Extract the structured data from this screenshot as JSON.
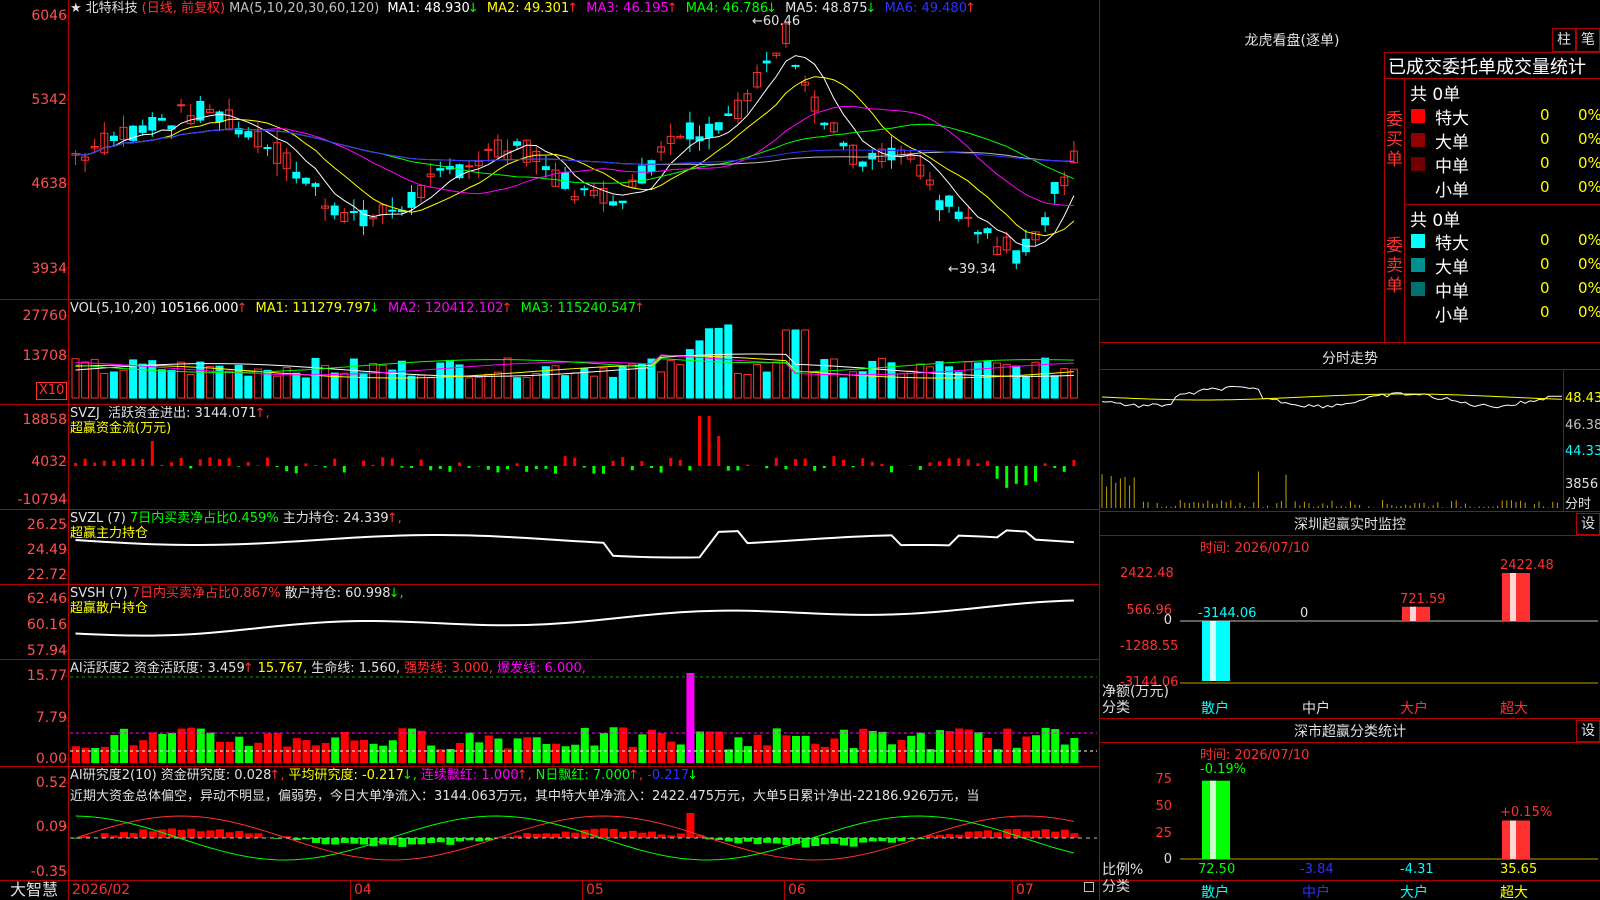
{
  "stock": {
    "star": "★",
    "name": "北特科技",
    "period": "(日线, 前复权)",
    "ma_params": "MA(5,10,20,30,60,120)"
  },
  "ma_values": [
    {
      "label": "MA1: 48.930",
      "arrow": "↓",
      "color": "#ffffff"
    },
    {
      "label": "MA2: 49.301",
      "arrow": "↑",
      "color": "#ffff00"
    },
    {
      "label": "MA3: 46.195",
      "arrow": "↑",
      "color": "#ff00ff"
    },
    {
      "label": "MA4: 46.786",
      "arrow": "↓",
      "color": "#00ff00"
    },
    {
      "label": "MA5: 48.875",
      "arrow": "↓",
      "color": "#c0c0c0"
    },
    {
      "label": "MA6: 49.480",
      "arrow": "↑",
      "color": "#3030ff"
    }
  ],
  "price_axis": [
    "6046",
    "5342",
    "4638",
    "3934"
  ],
  "high_mark": "60.46",
  "low_mark": "←39.34",
  "vol": {
    "header": "VOL(5,10,20)",
    "value": "105166.000",
    "value_arrow": "↑",
    "ma1": "MA1: 111279.797",
    "ma1_arrow": "↓",
    "ma2": "MA2: 120412.102",
    "ma2_arrow": "↑",
    "ma3": "MA3: 115240.547",
    "ma3_arrow": "↑",
    "axis": [
      "27760",
      "13708"
    ],
    "unit": "X10"
  },
  "svzj": {
    "header": "SVZJ",
    "label": "活跃资金进出: 3144.071",
    "arrow": "↑,",
    "sub": "超赢资金流(万元)",
    "axis": [
      "18858",
      "4032",
      "-10794"
    ]
  },
  "svzl": {
    "header": "SVZL (7)",
    "label": "7日内买卖净占比0.459%",
    "label2": "主力持仓: 24.339",
    "arrow": "↑,",
    "sub": "超赢主力持仓",
    "axis": [
      "26.25",
      "24.49",
      "22.72"
    ]
  },
  "svsh": {
    "header": "SVSH (7)",
    "label": "7日内买卖净占比0.867%",
    "label2": "散户持仓: 60.998",
    "arrow": "↓,",
    "sub": "超赢散户持仓",
    "axis": [
      "62.46",
      "60.16",
      "57.94"
    ]
  },
  "ai_active": {
    "header": "AI活跃度2",
    "v1": "资金活跃度: 3.459",
    "v1a": "↑",
    "v2": "15.767,",
    "v3": "生命线: 1.560,",
    "v4": "强势线: 3.000,",
    "v5": "爆发线: 6.000,",
    "axis": [
      "15.77",
      "7.79",
      "0.00"
    ]
  },
  "ai_research": {
    "header": "AI研究度2(10)",
    "v1": "资金研究度: 0.028",
    "v1a": "↑,",
    "v2": "平均研究度: -0.217",
    "v2a": "↓,",
    "v3": "连续飘红: 1.000",
    "v3a": "↑,",
    "v4": "N日飘红: 7.000",
    "v4a": "↑,",
    "v5": "-0.217",
    "v5a": "↓",
    "desc": "近期大资金总体偏空，异动不明显，偏弱势，今日大单净流入：3144.063万元，其中特大单净流入：2422.475万元，大单5日累计净出-22186.926万元，当",
    "axis": [
      "0.52",
      "0.09",
      "-0.35"
    ]
  },
  "bottom": {
    "logo": "大智慧",
    "dates": [
      "2026/02",
      "04",
      "05",
      "06",
      "07"
    ]
  },
  "dragon": {
    "title": "龙虎看盘(逐单)",
    "btn1": "柱",
    "btn2": "笔",
    "section_title": "已成交委托单成交量统计",
    "buy_side": "委买单",
    "sell_side": "委卖单",
    "buy_total": "共 0单",
    "sell_total": "共 0单",
    "buy_rows": [
      {
        "label": "特大",
        "v": "0",
        "p": "0%",
        "color": "#ff0000"
      },
      {
        "label": "大单",
        "v": "0",
        "p": "0%",
        "color": "#900000"
      },
      {
        "label": "中单",
        "v": "0",
        "p": "0%",
        "color": "#700000"
      },
      {
        "label": "小单",
        "v": "0",
        "p": "0%",
        "color": "#000000"
      }
    ],
    "sell_rows": [
      {
        "label": "特大",
        "v": "0",
        "p": "0%",
        "color": "#00ffff"
      },
      {
        "label": "大单",
        "v": "0",
        "p": "0%",
        "color": "#009090"
      },
      {
        "label": "中单",
        "v": "0",
        "p": "0%",
        "color": "#007070"
      },
      {
        "label": "小单",
        "v": "0",
        "p": "0%",
        "color": "#000000"
      }
    ]
  },
  "intraday": {
    "title": "分时走势",
    "axis": [
      "48.43",
      "46.38",
      "44.33"
    ],
    "vol": "3856",
    "unit": "分时"
  },
  "sz_monitor": {
    "title": "深圳超赢实时监控",
    "set": "设",
    "time": "时间: 2026/07/10",
    "axis": [
      "2422.48",
      "566.96",
      "0",
      "-1288.55",
      "-3144.06"
    ],
    "ylabel1": "净额(万元)",
    "ylabel2": "分类",
    "cats": [
      "散户",
      "中户",
      "大户",
      "超大"
    ],
    "values": [
      "-3144.06",
      "0",
      "721.59",
      "2422.48"
    ],
    "chart_data": {
      "type": "bar",
      "categories": [
        "散户",
        "中户",
        "大户",
        "超大"
      ],
      "values": [
        -3144.06,
        0,
        721.59,
        2422.48
      ],
      "ylabel": "净额(万元)"
    }
  },
  "sz_stats": {
    "title": "深市超赢分类统计",
    "set": "设",
    "time": "时间: 2026/07/10",
    "axis": [
      "75",
      "50",
      "25",
      "0"
    ],
    "ylabel1": "比例%",
    "ylabel2": "分类",
    "cats": [
      "散户",
      "中户",
      "大户",
      "超大"
    ],
    "values": [
      "72.50",
      "-3.84",
      "-4.31",
      "35.65"
    ],
    "changes": [
      "-0.19%",
      "+0.15%"
    ],
    "chart_data": {
      "type": "bar",
      "categories": [
        "散户",
        "中户",
        "大户",
        "超大"
      ],
      "values": [
        72.5,
        3.84,
        4.31,
        35.65
      ],
      "ylabel": "比例%"
    }
  }
}
